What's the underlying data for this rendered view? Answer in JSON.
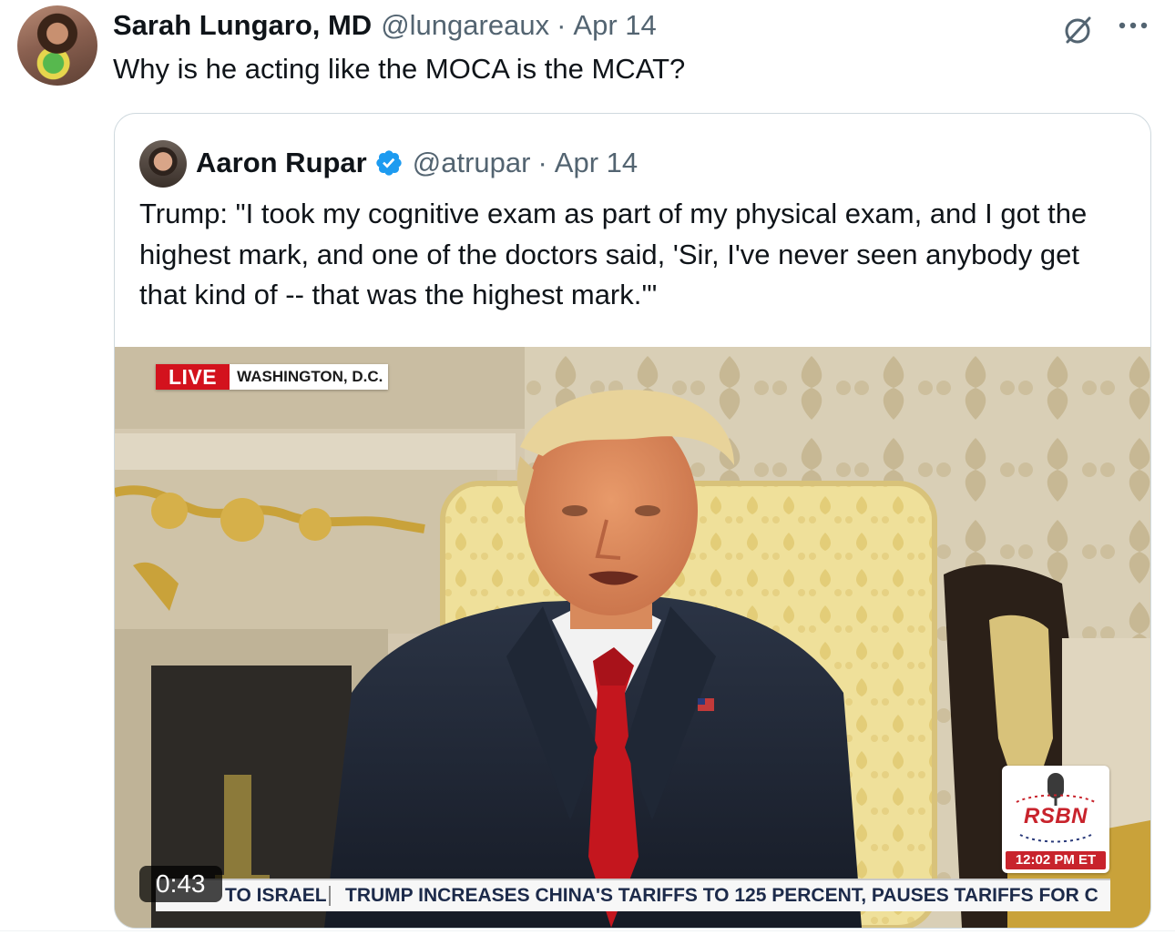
{
  "tweet": {
    "author_name": "Sarah Lungaro, MD",
    "author_handle": "@lungareaux",
    "separator": "·",
    "date": "Apr 14",
    "text": "Why is he acting like the MOCA is the MCAT?",
    "icons": {
      "grok": "grok-slash-circle-icon",
      "more": "more-horizontal-icon"
    }
  },
  "quoted_tweet": {
    "author_name": "Aaron Rupar",
    "verified_icon": "verified-badge-icon",
    "author_handle": "@atrupar",
    "separator": "·",
    "date": "Apr 14",
    "text": "Trump: \"I took my cognitive exam as part of my physical exam, and I got the highest mark, and one of the doctors said, 'Sir, I've never seen anybody get that kind of -- that was the highest mark.'\"",
    "video": {
      "live_label": "LIVE",
      "location": "WASHINGTON, D.C.",
      "network": "RSBN",
      "time": "12:02 PM ET",
      "ticker_prev": "TO ISRAEL",
      "ticker_headline": "TRUMP INCREASES CHINA'S TARIFFS TO 125 PERCENT, PAUSES TARIFFS FOR C",
      "duration": "0:43"
    }
  },
  "colors": {
    "text_primary": "#0f1419",
    "text_secondary": "#536471",
    "border": "#cfd9de",
    "verified_blue": "#1d9bf0",
    "live_red": "#d3121d",
    "rsbn_red": "#c8232c"
  }
}
